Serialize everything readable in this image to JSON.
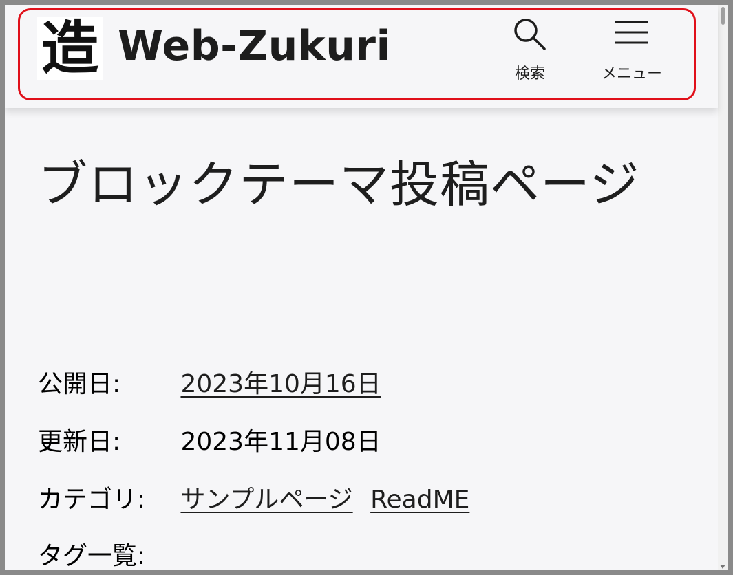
{
  "header": {
    "logo_char": "造",
    "site_title": "Web-Zukuri",
    "search_label": "検索",
    "menu_label": "メニュー",
    "highlight_color": "#e0101a"
  },
  "post": {
    "title": "ブロックテーマ投稿ページ",
    "meta": {
      "published_label": "公開日:",
      "published_value": "2023年10月16日",
      "updated_label": "更新日:",
      "updated_value": "2023年11月08日",
      "category_label": "カテゴリ:",
      "categories": [
        "サンプルページ",
        "ReadME"
      ],
      "tags_label": "タグ一覧:"
    }
  },
  "icons": {
    "search": "search-icon",
    "menu": "hamburger-menu-icon"
  }
}
